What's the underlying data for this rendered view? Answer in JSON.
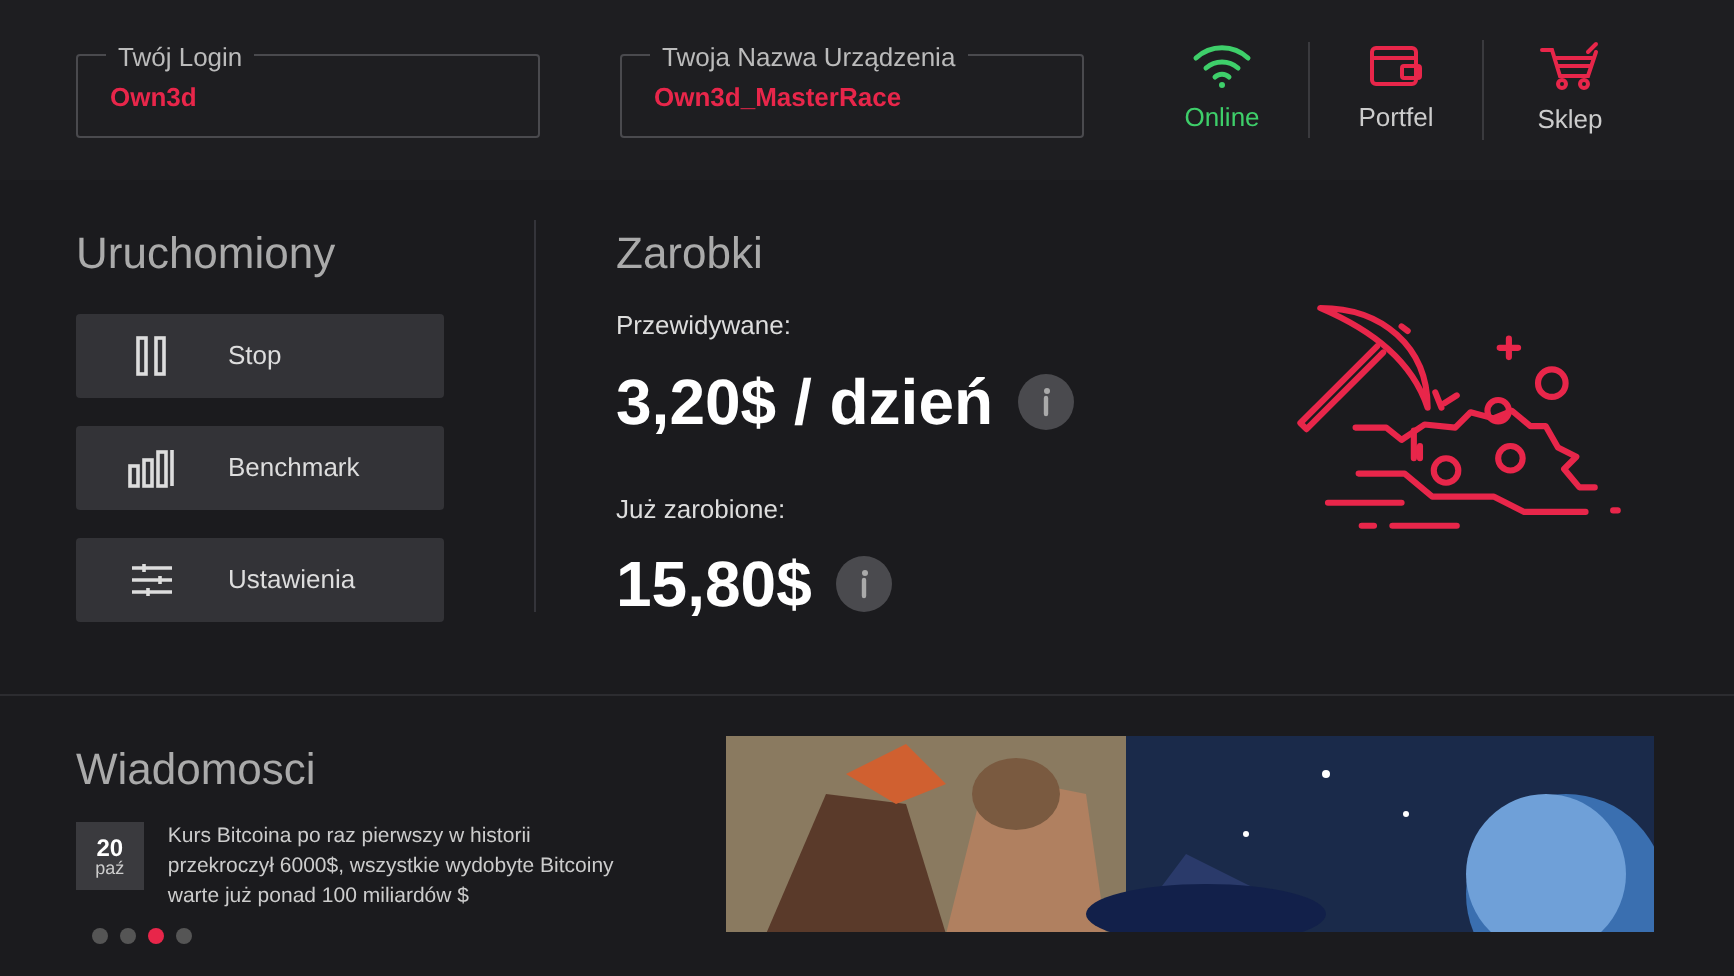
{
  "account_fields": [
    {
      "label": "Twój Login",
      "value": "Own3d"
    },
    {
      "label": "Twoja Nazwa Urządzenia",
      "value": "Own3d_MasterRace"
    }
  ],
  "top_nav": [
    {
      "kind": "wifi",
      "label": "Online"
    },
    {
      "kind": "wallet",
      "label": "Portfel"
    },
    {
      "kind": "cart",
      "label": "Sklep"
    }
  ],
  "status": {
    "title": "Uruchomiony",
    "buttons": [
      {
        "kind": "pause",
        "label": "Stop"
      },
      {
        "kind": "bars",
        "label": "Benchmark"
      },
      {
        "kind": "sliders",
        "label": "Ustawienia"
      }
    ]
  },
  "earnings": {
    "title": "Zarobki",
    "items": [
      {
        "label": "Przewidywane:",
        "value": "3,20$ / dzień"
      },
      {
        "label": "Już zarobione:",
        "value": "15,80$"
      }
    ]
  },
  "news": {
    "title": "Wiadomosci",
    "items": [
      {
        "day": "20",
        "month": "paź",
        "text": "Kurs Bitcoina po raz pierwszy w historii przekroczył 6000$, wszystkie wydobyte Bitcoiny warte już ponad 100 miliardów $"
      }
    ],
    "dots": [
      {
        "selected": false
      },
      {
        "selected": false
      },
      {
        "selected": true
      },
      {
        "selected": false
      }
    ]
  }
}
